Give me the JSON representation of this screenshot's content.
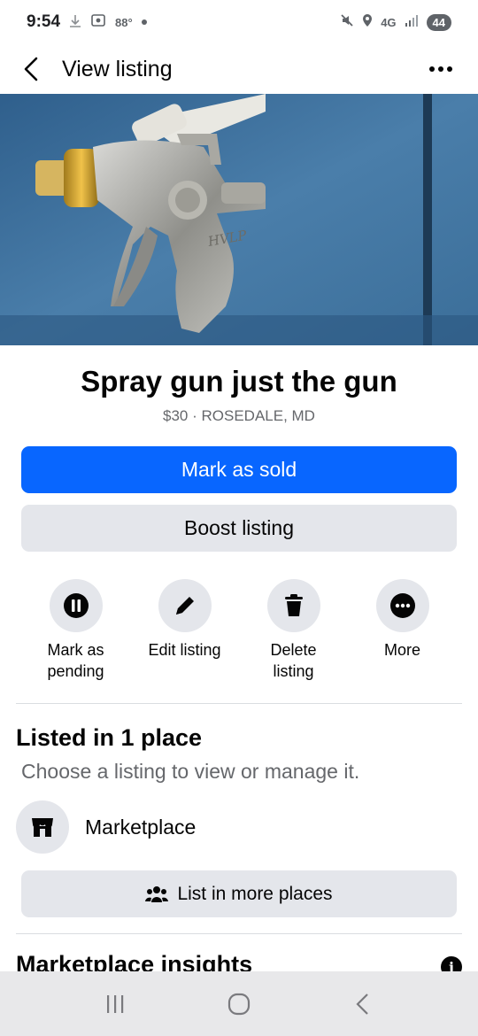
{
  "status_bar": {
    "time": "9:54",
    "temperature": "88°",
    "network": "4G",
    "battery": "44"
  },
  "header": {
    "title": "View listing"
  },
  "listing": {
    "title": "Spray gun just the gun",
    "subtitle": "$30 · ROSEDALE, MD",
    "photo_stamp": "HVLP"
  },
  "buttons": {
    "mark_sold": "Mark as sold",
    "boost": "Boost listing",
    "list_more": "List in more places"
  },
  "actions": [
    {
      "label": "Mark as\npending",
      "icon": "pause-icon"
    },
    {
      "label": "Edit listing",
      "icon": "pencil-icon"
    },
    {
      "label": "Delete\nlisting",
      "icon": "trash-icon"
    },
    {
      "label": "More",
      "icon": "more-icon"
    }
  ],
  "listed": {
    "title": "Listed in 1 place",
    "subtitle": "Choose a listing to view or manage it.",
    "places": [
      {
        "label": "Marketplace",
        "icon": "storefront-icon"
      }
    ]
  },
  "insights": {
    "title": "Marketplace insights"
  },
  "colors": {
    "primary": "#0866ff",
    "secondary_bg": "#e4e6eb",
    "muted_text": "#65676b"
  }
}
